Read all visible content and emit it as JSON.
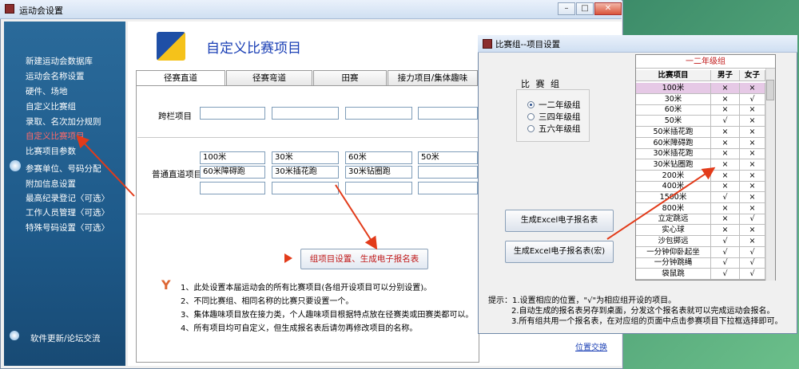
{
  "main_window": {
    "title": "运动会设置"
  },
  "sidebar": {
    "items": [
      {
        "label": "新建运动会数据库",
        "active": false
      },
      {
        "label": "运动会名称设置",
        "active": false
      },
      {
        "label": "硬件、场地",
        "active": false
      },
      {
        "label": "自定义比赛组",
        "active": false
      },
      {
        "label": "录取、名次加分规则",
        "active": false
      },
      {
        "label": "自定义比赛项目",
        "active": true
      },
      {
        "label": "比赛项目参数",
        "active": false
      },
      {
        "label": "参赛单位、号码分配",
        "active": false
      },
      {
        "label": "附加信息设置",
        "active": false
      },
      {
        "label": "最高纪录登记〈可选〉",
        "active": false
      },
      {
        "label": "工作人员管理〈可选〉",
        "active": false
      },
      {
        "label": "特殊号码设置〈可选〉",
        "active": false
      }
    ],
    "footer": "软件更新/论坛交流"
  },
  "page": {
    "title": "自定义比赛项目",
    "tabs": [
      "径赛直道",
      "径赛弯道",
      "田赛",
      "接力项目/集体趣味"
    ],
    "rows": {
      "hurdles_label": "跨栏项目",
      "straight_label": "普通直道项目",
      "straight_values": [
        [
          "100米",
          "30米",
          "60米",
          "50米"
        ],
        [
          "60米障碍跑",
          "30米插花跑",
          "30米钻圈跑",
          ""
        ],
        [
          "",
          "",
          "",
          ""
        ]
      ]
    },
    "gen_button": "组项目设置、生成电子报名表",
    "notes": [
      "1、此处设置本届运动会的所有比赛项目(各组开设项目可以分别设置)。",
      "2、不同比赛组、相同名称的比赛只要设置一个。",
      "3、集体趣味项目放在接力类，个人趣味项目根据特点放在径赛类或田赛类都可以。",
      "4、所有项目均可自定义，但生成报名表后请勿再修改项目的名称。"
    ],
    "position_link": "位置交换"
  },
  "dialog": {
    "title": "比赛组--项目设置",
    "group_label": "比 赛 组",
    "groups": [
      {
        "label": "一二年级组",
        "selected": true
      },
      {
        "label": "三四年级组",
        "selected": false
      },
      {
        "label": "五六年级组",
        "selected": false
      }
    ],
    "btn_generate": "生成Excel电子报名表",
    "btn_generate_macro": "生成Excel电子报名表(宏)",
    "table_title": "一二年级组",
    "columns": [
      "比赛项目",
      "男子",
      "女子"
    ],
    "rows": [
      [
        "100米",
        "×",
        "×"
      ],
      [
        "30米",
        "×",
        "√"
      ],
      [
        "60米",
        "×",
        "×"
      ],
      [
        "50米",
        "√",
        "×"
      ],
      [
        "50米插花跑",
        "×",
        "×"
      ],
      [
        "60米障碍跑",
        "×",
        "×"
      ],
      [
        "30米插花跑",
        "×",
        "×"
      ],
      [
        "30米钻圈跑",
        "×",
        "×"
      ],
      [
        "200米",
        "×",
        "×"
      ],
      [
        "400米",
        "×",
        "×"
      ],
      [
        "1500米",
        "√",
        "×"
      ],
      [
        "800米",
        "×",
        "×"
      ],
      [
        "立定跳远",
        "×",
        "√"
      ],
      [
        "实心球",
        "×",
        "×"
      ],
      [
        "沙包掷远",
        "√",
        "×"
      ],
      [
        "一分钟仰卧起坐",
        "√",
        "√"
      ],
      [
        "一分钟跳绳",
        "√",
        "√"
      ],
      [
        "袋鼠跳",
        "√",
        "√"
      ]
    ],
    "hints": [
      "提示：1.设置相应的位置，\"√\"为相应组开设的项目。",
      "2.自动生成的报名表另存到桌面，分发这个报名表就可以完成运动会报名。",
      "3.所有组共用一个报名表，在对应组的页面中点击参赛项目下拉框选择即可。"
    ]
  },
  "colors": {
    "accent_red": "#c01818",
    "title_blue": "#1a3fb5",
    "sidebar_blue": "#1e5a8a"
  }
}
